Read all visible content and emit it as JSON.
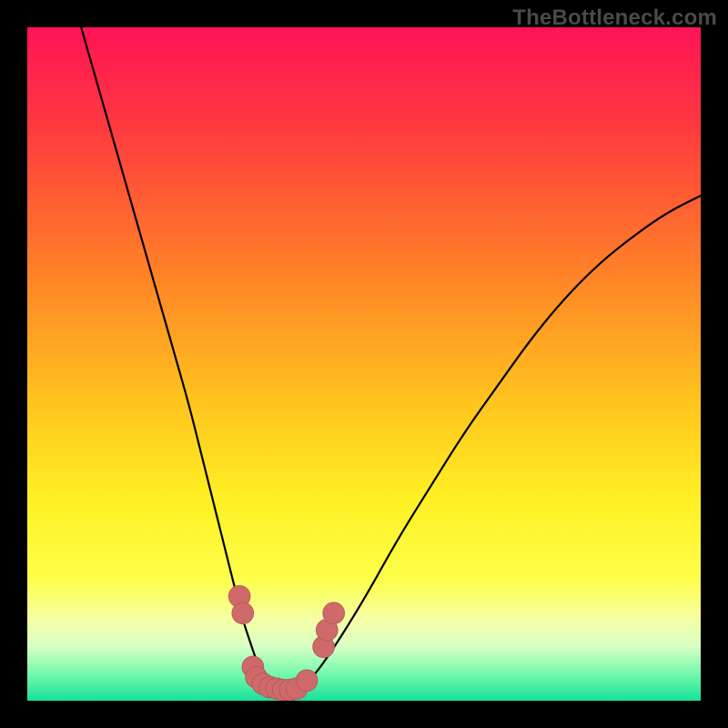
{
  "watermark": "TheBottleneck.com",
  "colors": {
    "background": "#000000",
    "curve_stroke": "#000000",
    "marker_fill": "#cf6a6a",
    "marker_stroke": "#b95a5a"
  },
  "chart_data": {
    "type": "line",
    "title": "",
    "xlabel": "",
    "ylabel": "",
    "xlim": [
      0,
      100
    ],
    "ylim": [
      0,
      100
    ],
    "grid": false,
    "legend": false,
    "gradient_stops": [
      {
        "offset": 0.0,
        "color": "#ff1356"
      },
      {
        "offset": 0.15,
        "color": "#ff3a3f"
      },
      {
        "offset": 0.35,
        "color": "#ff7d29"
      },
      {
        "offset": 0.55,
        "color": "#ffc21e"
      },
      {
        "offset": 0.7,
        "color": "#fff023"
      },
      {
        "offset": 0.82,
        "color": "#fdff4a"
      },
      {
        "offset": 0.88,
        "color": "#f5ffa6"
      },
      {
        "offset": 0.92,
        "color": "#d7ffc4"
      },
      {
        "offset": 0.96,
        "color": "#74f9ac"
      },
      {
        "offset": 1.0,
        "color": "#18e19b"
      }
    ],
    "series": [
      {
        "name": "bottleneck-curve",
        "x": [
          8,
          10,
          12,
          14,
          16,
          18,
          20,
          22,
          24,
          26,
          28,
          30,
          32,
          33,
          34,
          35,
          36,
          37,
          38,
          39,
          40,
          42,
          45,
          50,
          55,
          60,
          65,
          70,
          75,
          80,
          85,
          90,
          95,
          100
        ],
        "y": [
          100,
          93,
          86,
          79,
          72,
          65,
          58,
          51,
          44,
          36,
          28,
          20,
          12,
          9,
          6,
          3.5,
          2,
          1.2,
          1,
          1,
          1.5,
          3,
          7,
          15,
          24,
          32,
          40,
          47,
          54,
          60,
          65,
          69,
          72.5,
          75
        ]
      }
    ],
    "markers": {
      "name": "optimum-cluster",
      "points": [
        {
          "x": 31.5,
          "y": 15.5
        },
        {
          "x": 32.0,
          "y": 13.0
        },
        {
          "x": 33.5,
          "y": 5.0
        },
        {
          "x": 34.0,
          "y": 3.5
        },
        {
          "x": 35.0,
          "y": 2.5
        },
        {
          "x": 36.0,
          "y": 2.0
        },
        {
          "x": 37.0,
          "y": 1.8
        },
        {
          "x": 38.0,
          "y": 1.6
        },
        {
          "x": 39.0,
          "y": 1.6
        },
        {
          "x": 40.0,
          "y": 1.8
        },
        {
          "x": 41.5,
          "y": 3.0
        },
        {
          "x": 44.0,
          "y": 8.0
        },
        {
          "x": 44.5,
          "y": 10.5
        },
        {
          "x": 45.5,
          "y": 13.0
        }
      ],
      "radius_data_units": 1.6
    }
  }
}
